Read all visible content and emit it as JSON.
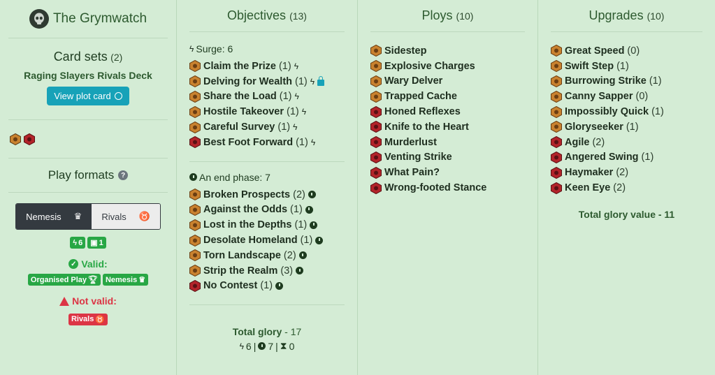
{
  "warband": {
    "name": "The Grymwatch"
  },
  "card_sets": {
    "title": "Card sets",
    "count": "(2)",
    "deck_name": "Raging Slayers Rivals Deck",
    "view_plot_label": "View plot card"
  },
  "set_icons": [
    "rivals-set-icon",
    "red-set-icon"
  ],
  "play_formats": {
    "title": "Play formats",
    "options": [
      {
        "label": "Nemesis",
        "icon": "crown-icon",
        "active": true
      },
      {
        "label": "Rivals",
        "icon": "medal-icon",
        "active": false
      }
    ],
    "stat_pills": [
      {
        "icon": "bolt-icon",
        "value": "6"
      },
      {
        "icon": "lock-icon",
        "value": "1"
      }
    ],
    "valid_label": "Valid:",
    "valid_formats": [
      {
        "label": "Organised Play",
        "icon": "trophy-icon"
      },
      {
        "label": "Nemesis",
        "icon": "crown-icon"
      }
    ],
    "not_valid_label": "Not valid:",
    "invalid_formats": [
      {
        "label": "Rivals",
        "icon": "medal-icon"
      }
    ]
  },
  "objectives": {
    "title": "Objectives",
    "count": "(13)",
    "groups": [
      {
        "label": "Surge: 6",
        "icon": "bolt-icon",
        "cards": [
          {
            "name": "Claim the Prize",
            "qty": "(1)",
            "set": "rivals",
            "icons": [
              "bolt"
            ]
          },
          {
            "name": "Delving for Wealth",
            "qty": "(1)",
            "set": "rivals",
            "icons": [
              "bolt",
              "lock"
            ]
          },
          {
            "name": "Share the Load",
            "qty": "(1)",
            "set": "rivals",
            "icons": [
              "bolt"
            ]
          },
          {
            "name": "Hostile Takeover",
            "qty": "(1)",
            "set": "rivals",
            "icons": [
              "bolt"
            ]
          },
          {
            "name": "Careful Survey",
            "qty": "(1)",
            "set": "rivals",
            "icons": [
              "bolt"
            ]
          },
          {
            "name": "Best Foot Forward",
            "qty": "(1)",
            "set": "red",
            "icons": [
              "bolt"
            ]
          }
        ]
      },
      {
        "label": "An end phase: 7",
        "icon": "clock-icon",
        "cards": [
          {
            "name": "Broken Prospects",
            "qty": "(2)",
            "set": "rivals",
            "icons": [
              "clock"
            ]
          },
          {
            "name": "Against the Odds",
            "qty": "(1)",
            "set": "rivals",
            "icons": [
              "clock"
            ]
          },
          {
            "name": "Lost in the Depths",
            "qty": "(1)",
            "set": "rivals",
            "icons": [
              "clock"
            ]
          },
          {
            "name": "Desolate Homeland",
            "qty": "(1)",
            "set": "rivals",
            "icons": [
              "clock"
            ]
          },
          {
            "name": "Torn Landscape",
            "qty": "(2)",
            "set": "rivals",
            "icons": [
              "clock"
            ]
          },
          {
            "name": "Strip the Realm",
            "qty": "(3)",
            "set": "rivals",
            "icons": [
              "clock"
            ]
          },
          {
            "name": "No Contest",
            "qty": "(1)",
            "set": "red",
            "icons": [
              "clock"
            ]
          }
        ]
      }
    ],
    "total_label": "Total glory",
    "total_value": "- 17",
    "stats": {
      "surge": "6",
      "end_phase": "7",
      "third": "0"
    }
  },
  "ploys": {
    "title": "Ploys",
    "count": "(10)",
    "cards": [
      {
        "name": "Sidestep",
        "set": "rivals"
      },
      {
        "name": "Explosive Charges",
        "set": "rivals"
      },
      {
        "name": "Wary Delver",
        "set": "rivals"
      },
      {
        "name": "Trapped Cache",
        "set": "rivals"
      },
      {
        "name": "Honed Reflexes",
        "set": "red"
      },
      {
        "name": "Knife to the Heart",
        "set": "red"
      },
      {
        "name": "Murderlust",
        "set": "red"
      },
      {
        "name": "Venting Strike",
        "set": "red"
      },
      {
        "name": "What Pain?",
        "set": "red"
      },
      {
        "name": "Wrong-footed Stance",
        "set": "red"
      }
    ]
  },
  "upgrades": {
    "title": "Upgrades",
    "count": "(10)",
    "cards": [
      {
        "name": "Great Speed",
        "qty": "(0)",
        "set": "rivals"
      },
      {
        "name": "Swift Step",
        "qty": "(1)",
        "set": "rivals"
      },
      {
        "name": "Burrowing Strike",
        "qty": "(1)",
        "set": "rivals"
      },
      {
        "name": "Canny Sapper",
        "qty": "(0)",
        "set": "rivals"
      },
      {
        "name": "Impossibly Quick",
        "qty": "(1)",
        "set": "rivals"
      },
      {
        "name": "Gloryseeker",
        "qty": "(1)",
        "set": "rivals"
      },
      {
        "name": "Agile",
        "qty": "(2)",
        "set": "red"
      },
      {
        "name": "Angered Swing",
        "qty": "(1)",
        "set": "red"
      },
      {
        "name": "Haymaker",
        "qty": "(2)",
        "set": "red"
      },
      {
        "name": "Keen Eye",
        "qty": "(2)",
        "set": "red"
      }
    ],
    "total_label": "Total glory value - 11"
  },
  "colors": {
    "rivals_icon": "#c9822f",
    "red_icon": "#b3242a",
    "background": "#d4ecd5",
    "accent": "#17a2b8"
  }
}
